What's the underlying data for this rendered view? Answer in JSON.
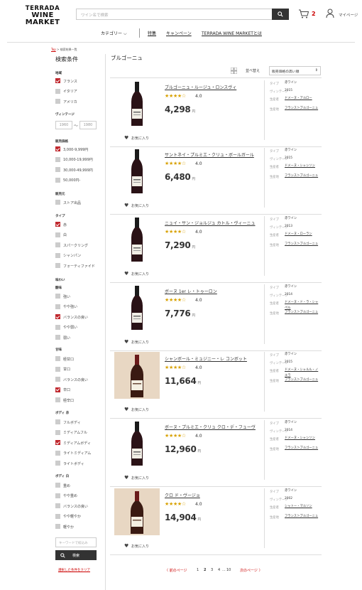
{
  "header": {
    "logo_line1": "TERRADA",
    "logo_line2": "WINE MARKET",
    "search_placeholder": "ワイン名で検索",
    "cart_count": "2",
    "mypage_label": "マイページ"
  },
  "nav": {
    "category": "カテゴリー",
    "feature": "特集",
    "campaign": "キャンペーン",
    "about": "TERRADA WINE MARKETとは"
  },
  "breadcrumb": {
    "top": "Top",
    "current": "検索結果一覧"
  },
  "sidebar": {
    "title": "検索条件",
    "region_label": "地域",
    "regions": [
      {
        "label": "フランス",
        "checked": true
      },
      {
        "label": "イタリア",
        "checked": false
      },
      {
        "label": "アメリカ",
        "checked": false
      }
    ],
    "vintage_label": "ヴィンテージ",
    "vintage_from": "1960",
    "vintage_sep": "〜",
    "vintage_to": "1980",
    "price_label": "販売価格",
    "prices": [
      {
        "label": "3,000-9,999円",
        "checked": true
      },
      {
        "label": "10,000-19,999円",
        "checked": false
      },
      {
        "label": "30,000-49,999円",
        "checked": false
      },
      {
        "label": "50,000円-",
        "checked": false
      }
    ],
    "store_label": "販売元",
    "store": [
      {
        "label": "ストア出品",
        "checked": false
      }
    ],
    "type_label": "タイプ",
    "types": [
      {
        "label": "赤",
        "checked": true
      },
      {
        "label": "白",
        "checked": false
      },
      {
        "label": "スパークリング",
        "checked": false
      },
      {
        "label": "シャンパン",
        "checked": false
      },
      {
        "label": "フォーティファイド",
        "checked": false
      }
    ],
    "taste_label": "味わい",
    "acidity_label": "酸味",
    "acidity": [
      {
        "label": "強い",
        "checked": false
      },
      {
        "label": "やや強い",
        "checked": false
      },
      {
        "label": "バランスの良い",
        "checked": true
      },
      {
        "label": "やや弱い",
        "checked": false
      },
      {
        "label": "弱い",
        "checked": false
      }
    ],
    "sweet_label": "甘味",
    "sweet": [
      {
        "label": "極甘口",
        "checked": false
      },
      {
        "label": "甘口",
        "checked": false
      },
      {
        "label": "バランスの良い",
        "checked": false
      },
      {
        "label": "辛口",
        "checked": true
      },
      {
        "label": "極辛口",
        "checked": false
      }
    ],
    "body_red_label": "ボディ 赤",
    "body_red": [
      {
        "label": "フルボディ",
        "checked": false
      },
      {
        "label": "ミディアムフル",
        "checked": false
      },
      {
        "label": "ミディアムボディ",
        "checked": true
      },
      {
        "label": "ライトミディアム",
        "checked": false
      },
      {
        "label": "ライトボディ",
        "checked": false
      }
    ],
    "body_white_label": "ボディ 白",
    "body_white": [
      {
        "label": "重め",
        "checked": false
      },
      {
        "label": "やや重め",
        "checked": false
      },
      {
        "label": "バランスの良い",
        "checked": false
      },
      {
        "label": "やや軽やか",
        "checked": false
      },
      {
        "label": "軽やか",
        "checked": false
      }
    ],
    "keyword_placeholder": "キーワードで絞込み",
    "search_button": "検索",
    "clear_link": "選択した条件をクリア"
  },
  "results": {
    "title": "ブルゴーニュ",
    "sort_label": "並べ替え",
    "sort_value": "販売価格の高い順",
    "fav_label": "お気に入り",
    "yen": "円",
    "meta_type": "タイプ",
    "meta_vintage": "ヴィンテージ",
    "meta_producer": "生産者",
    "meta_origin": "生産地",
    "products": [
      {
        "name": "ブルゴーニュ・ルージュ・ロンスヴィ",
        "rating": "4.0",
        "price": "4,298",
        "type": "赤ワイン",
        "vintage": "2015",
        "producer": "ドメーヌ・アルロー",
        "origin": "フランス＞ブルゴーニュ",
        "image": "bottle"
      },
      {
        "name": "サントネイ・プルミエ・クリュ・ボールガール",
        "rating": "4.0",
        "price": "6,480",
        "type": "赤ワイン",
        "vintage": "2015",
        "producer": "ドメーヌ・シャンソン",
        "origin": "フランス＞ブルゴーニュ",
        "image": "bottle"
      },
      {
        "name": "ニュイ・サン・ジョルジュ カトル・ヴィーニュ",
        "rating": "4.0",
        "price": "7,290",
        "type": "赤ワイン",
        "vintage": "2013",
        "producer": "ドメーヌ・ローラン",
        "origin": "フランス＞ブルゴーニュ",
        "image": "bottle"
      },
      {
        "name": "ボーヌ 1er レ・トゥーロン",
        "rating": "4.0",
        "price": "7,776",
        "type": "赤ワイン",
        "vintage": "2014",
        "producer": "ドメーヌ・ド・ラ・シャペル",
        "origin": "フランス＞ブルゴーニュ",
        "image": "bottle"
      },
      {
        "name": "シャンボール・ミュジニー・レ コンボット",
        "rating": "4.0",
        "price": "11,664",
        "type": "赤ワイン",
        "vintage": "2015",
        "producer": "ドメーヌ・シャルル・ノエラ",
        "origin": "フランス＞ブルゴーニュ",
        "image": "photo"
      },
      {
        "name": "ボーヌ・プルミエ・クリュ クロ・デ・フューヴ",
        "rating": "4.0",
        "price": "12,960",
        "type": "赤ワイン",
        "vintage": "2014",
        "producer": "ドメーヌ・シャンソン",
        "origin": "フランス＞ブルゴーニュ",
        "image": "bottle"
      },
      {
        "name": "クロ ド・ヴージョ",
        "rating": "4.0",
        "price": "14,904",
        "type": "赤ワイン",
        "vintage": "2002",
        "producer": "シャトー・マルソン",
        "origin": "フランス＞ブルゴーニュ",
        "image": "photo"
      }
    ]
  },
  "pager": {
    "prev": "〈 前のページ",
    "pages": [
      "1",
      "2",
      "3",
      "4",
      "...",
      "10"
    ],
    "current": "2",
    "next": "次のページ 〉"
  },
  "colors": {
    "accent": "#c0282e",
    "star": "#d8a100",
    "dark": "#333333"
  }
}
